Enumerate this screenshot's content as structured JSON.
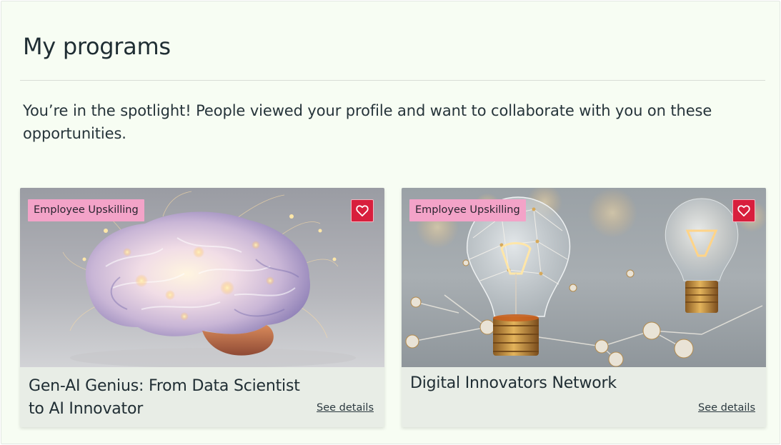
{
  "header": {
    "title": "My programs",
    "intro": "You’re in the spotlight! People viewed your profile and want to collaborate with you on these opportunities."
  },
  "programs": [
    {
      "tag": "Employee Upskilling",
      "title": "Gen-AI Genius: From Data Scientist to AI Innovator",
      "link_label": "See details",
      "image": "glowing-brain"
    },
    {
      "tag": "Employee Upskilling",
      "title": "Digital Innovators Network",
      "link_label": "See details",
      "image": "network-light-bulbs"
    }
  ],
  "colors": {
    "panel_background": "#f7fdf3",
    "tag_background": "#f3a3c8",
    "favorite_button": "#d81f3d",
    "card_background": "#e8ede6"
  },
  "icons": {
    "favorite": "heart-outline-icon"
  }
}
